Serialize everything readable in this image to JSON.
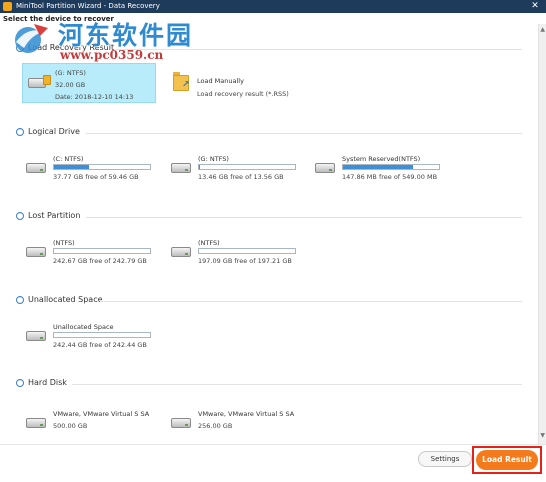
{
  "window": {
    "title": "MiniTool Partition Wizard - Data Recovery",
    "close_glyph": "✕"
  },
  "watermark": {
    "title": "河东软件园",
    "url": "www.pc0359.cn"
  },
  "subtitle": "Select the device to recover",
  "sections": {
    "load_recovery": {
      "label": "Load Recovery Result",
      "selected": {
        "name": "(G: NTFS)",
        "size": "32.00 GB",
        "date": "Date: 2018-12-10 14:13"
      },
      "load_manually": {
        "title": "Load Manually",
        "desc": "Load recovery result (*.RSS)"
      }
    },
    "logical": {
      "label": "Logical Drive",
      "items": [
        {
          "name": "(C: NTFS)",
          "free": "37.77 GB free of 59.46 GB",
          "used_fraction": 0.36
        },
        {
          "name": "(G: NTFS)",
          "free": "13.46 GB free of 13.56 GB",
          "used_fraction": 0.01
        },
        {
          "name": "System Reserved(NTFS)",
          "free": "147.86 MB free of 549.00 MB",
          "used_fraction": 0.73
        }
      ]
    },
    "lost": {
      "label": "Lost Partition",
      "items": [
        {
          "name": "(NTFS)",
          "free": "242.67 GB free of 242.79 GB",
          "used_fraction": 0.0
        },
        {
          "name": "(NTFS)",
          "free": "197.09 GB free of 197.21 GB",
          "used_fraction": 0.0
        }
      ]
    },
    "unallocated": {
      "label": "Unallocated Space",
      "items": [
        {
          "name": "Unallocated Space",
          "free": "242.44 GB free of 242.44 GB",
          "used_fraction": 0.0
        }
      ]
    },
    "hard_disk": {
      "label": "Hard Disk",
      "items": [
        {
          "name": "VMware, VMware Virtual S SA",
          "free": "500.00 GB"
        },
        {
          "name": "VMware, VMware Virtual S SA",
          "free": "256.00 GB"
        }
      ]
    }
  },
  "footer": {
    "settings_label": "Settings",
    "load_result_label": "Load Result"
  },
  "colors": {
    "accent": "#3e8fd6",
    "selected_bg": "#b8ecfa",
    "load_button": "#f47a1c",
    "highlight_border": "#e2231a"
  }
}
